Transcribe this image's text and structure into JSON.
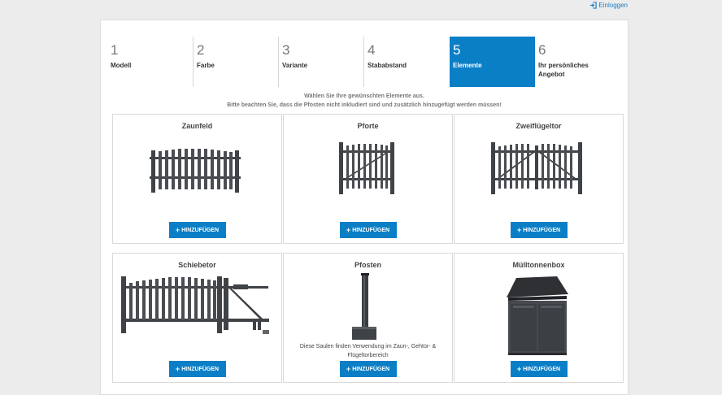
{
  "header": {
    "login_label": "Einloggen",
    "login_icon": "sign-in-icon"
  },
  "steps": [
    {
      "num": "1",
      "label": "Modell"
    },
    {
      "num": "2",
      "label": "Farbe"
    },
    {
      "num": "3",
      "label": "Variante"
    },
    {
      "num": "4",
      "label": "Stababstand"
    },
    {
      "num": "5",
      "label": "Elemente"
    },
    {
      "num": "6",
      "label": "Ihr persönliches Angebot"
    }
  ],
  "active_step": "5",
  "intro": {
    "line1": "Wählen Sie Ihre gewünschten Elemente aus.",
    "line2": "Bitte beachten Sie, dass die Pfosten nicht inkludiert sind und zusätzlich hinzugefügt werden müssen!"
  },
  "elements": [
    {
      "title": "Zaunfeld",
      "button": "HINZUFÜGEN",
      "image": "fence-panel"
    },
    {
      "title": "Pforte",
      "button": "HINZUFÜGEN",
      "image": "gate"
    },
    {
      "title": "Zweiflügeltor",
      "button": "HINZUFÜGEN",
      "image": "double-gate"
    },
    {
      "title": "Schiebetor",
      "button": "HINZUFÜGEN",
      "image": "sliding-gate"
    },
    {
      "title": "Pfosten",
      "button": "HINZUFÜGEN",
      "image": "post",
      "description": "Diese Saulen finden Verwendung im Zaun-, Gehtür- & Flügeltorbereich"
    },
    {
      "title": "Mülltonnenbox",
      "button": "HINZUFÜGEN",
      "image": "bin-box"
    }
  ],
  "colors": {
    "accent": "#0b7fc6",
    "metal": "#3f4246",
    "background": "#ececec"
  }
}
